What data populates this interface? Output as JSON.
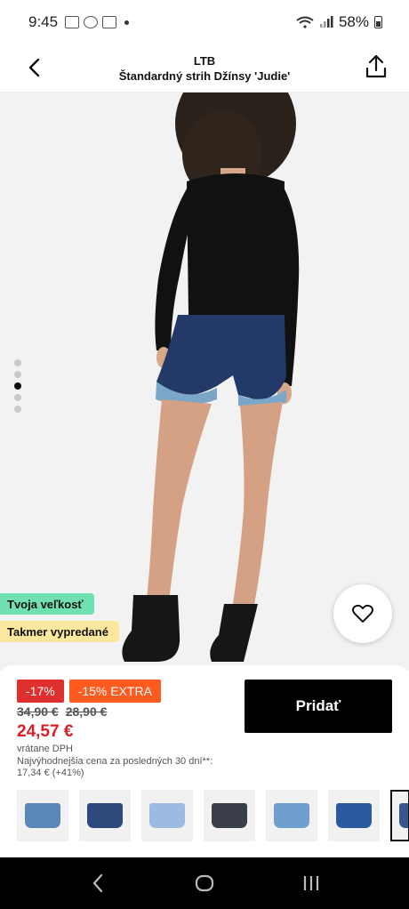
{
  "status_bar": {
    "time": "9:45",
    "battery": "58%"
  },
  "header": {
    "brand": "LTB",
    "title": "Štandardný strih Džínsy 'Judie'"
  },
  "icons": {
    "back": "chevron-left-icon",
    "share": "share-icon",
    "wishlist": "heart-icon"
  },
  "gallery": {
    "dot_count": 4,
    "active_index": 2
  },
  "badges": {
    "size": "Tvoja veľkosť",
    "sold": "Takmer vypredané"
  },
  "pricing": {
    "discount": "-17%",
    "extra": "-15% EXTRA",
    "old_price_1": "34,90 €",
    "old_price_2": "28,90 €",
    "price": "24,57 €",
    "vat": "vrátane DPH",
    "lowest_label": "Najvýhodnejšia cena za posledných 30 dní**:",
    "lowest_value": "17,34 € (+41%)"
  },
  "actions": {
    "add_label": "Pridať"
  },
  "variants": [
    {
      "color": "#5a86b8"
    },
    {
      "color": "#2c4a7c"
    },
    {
      "color": "#9cbbe0"
    },
    {
      "color": "#3a3f4a"
    },
    {
      "color": "#6f9fcf"
    },
    {
      "color": "#2b5aa0"
    },
    {
      "color": "#34588e"
    }
  ],
  "colors": {
    "sale_red": "#e02f2f",
    "extra_orange": "#ff5a1f",
    "price_red": "#d81f26",
    "size_badge": "#6fe0b0",
    "sold_badge": "#fbe79d"
  }
}
